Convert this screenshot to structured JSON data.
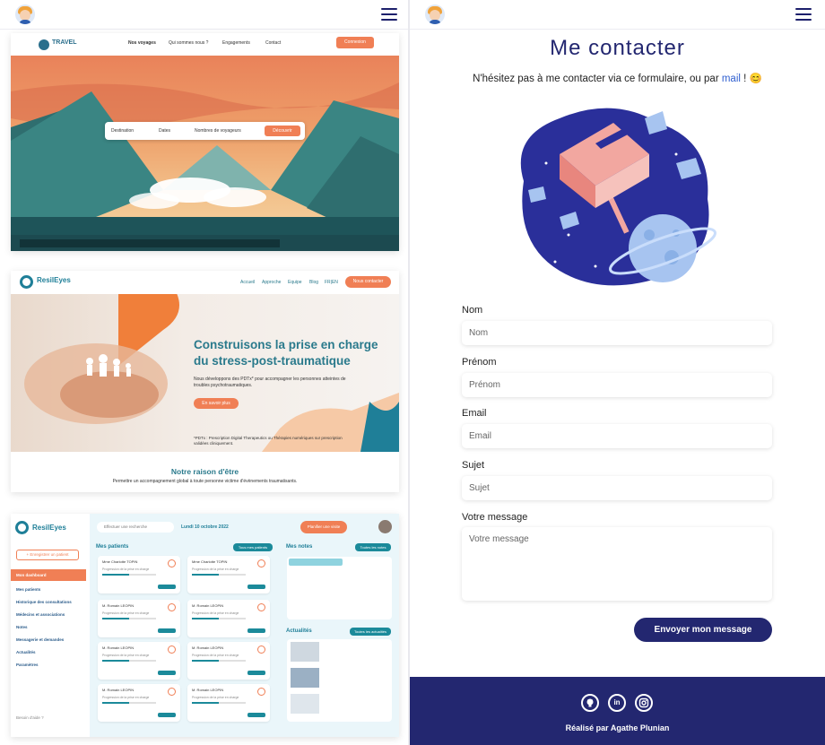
{
  "left": {
    "travel": {
      "brand": "TRAVEL",
      "nav": [
        "Nos voyages",
        "Qui sommes nous ?",
        "Engagements",
        "Contact"
      ],
      "cta": "Connexion",
      "search": [
        "Destination",
        "Dates",
        "Nombres de voyageurs"
      ],
      "search_cta": "Découvrir"
    },
    "resil": {
      "brand": "ResilEyes",
      "nav": [
        "Accueil",
        "Approche",
        "Equipe",
        "Blog",
        "FR|EN"
      ],
      "cta": "Nous contacter",
      "title": "Construisons la prise en charge du stress-post-traumatique",
      "text": "Nous développons des PDTx* pour accompagner les personnes atteintes de troubles psychotraumatiques.",
      "more": "En savoir plus",
      "note": "*PDTx : Prescription Digital Therapeutics ou Thérapies numériques sur prescription validées cliniquement.",
      "section_title": "Notre raison d'être",
      "section_text": "Permettre un accompagnement global à toute personne victime d'évènements traumatisants."
    },
    "dash": {
      "brand": "ResilEyes",
      "search_placeholder": "Effectuer une recherche",
      "date": "Lundi 10 octobre 2022",
      "add_patient": "+ Enregistrer un patient",
      "menu": [
        "Mon dashboard",
        "Mes patients",
        "Historique des consultations",
        "Médecins et associations",
        "Notes",
        "Messagerie et demandes",
        "Actualités",
        "Paramètres"
      ],
      "help": "Besoin d'aide ?",
      "patients_title": "Mes patients",
      "all_patients": "Tous mes patients",
      "notes_title": "Mes notes",
      "all_notes": "Toutes les notes",
      "news_title": "Actualités",
      "all_news": "Toutes les actualités",
      "new_visit": "Planifier une visite",
      "patient_name": "M. Romain LEOPIN",
      "first_patient": "Mme Charlotte TOPIN",
      "progress_label": "Progression de la prise en charge",
      "view": "Voir fiche"
    }
  },
  "right": {
    "title": "Me contacter",
    "intro_before": "N'hésitez pas à me contacter via ce formulaire, ou par ",
    "intro_link": "mail",
    "intro_after": " ! 😊",
    "fields": {
      "nom": {
        "label": "Nom",
        "placeholder": "Nom"
      },
      "prenom": {
        "label": "Prénom",
        "placeholder": "Prénom"
      },
      "email": {
        "label": "Email",
        "placeholder": "Email"
      },
      "sujet": {
        "label": "Sujet",
        "placeholder": "Sujet"
      },
      "message": {
        "label": "Votre message",
        "placeholder": "Votre message"
      }
    },
    "submit": "Envoyer mon message",
    "footer_icons": [
      "github-icon",
      "linkedin-icon",
      "instagram-icon"
    ],
    "credit": "Réalisé par Agathe Plunian"
  }
}
